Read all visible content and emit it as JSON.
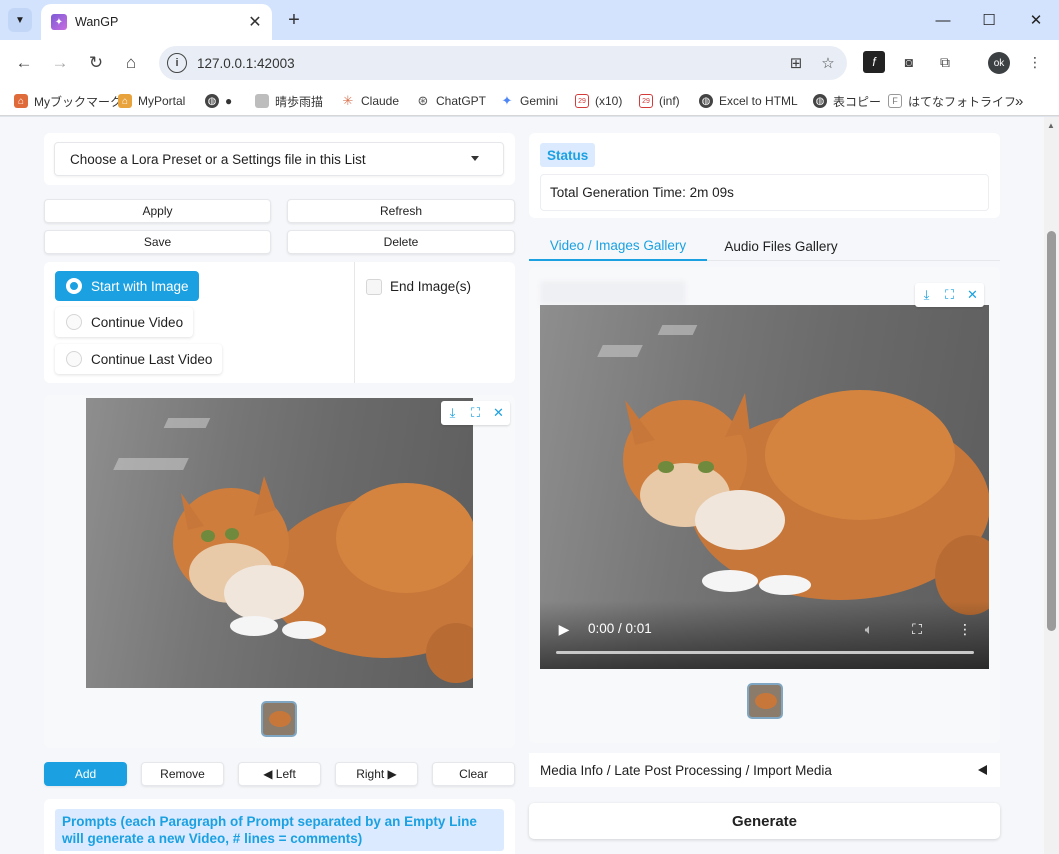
{
  "browser": {
    "tab_title": "WanGP",
    "url": "127.0.0.1:42003",
    "profile_initials": "ok",
    "bookmarks": [
      {
        "label": "Myブックマーク",
        "icon": "house-icon",
        "color": "#e06b3a"
      },
      {
        "label": "MyPortal",
        "icon": "house-icon",
        "color": "#e8a33c"
      },
      {
        "label": "●",
        "icon": "globe-icon",
        "color": "#444444"
      },
      {
        "label": "晴歩雨描",
        "icon": "page-icon",
        "color": "#9e9e9e"
      },
      {
        "label": "Claude",
        "icon": "claude-icon",
        "color": "#d97757"
      },
      {
        "label": "ChatGPT",
        "icon": "chatgpt-icon",
        "color": "#555555"
      },
      {
        "label": "Gemini",
        "icon": "gemini-icon",
        "color": "#4f86f7"
      },
      {
        "label": "(x10)",
        "icon": "calendar-icon",
        "color": "#d33b3b"
      },
      {
        "label": "(inf)",
        "icon": "calendar-icon",
        "color": "#d33b3b"
      },
      {
        "label": "Excel to HTML",
        "icon": "globe-icon",
        "color": "#444444"
      },
      {
        "label": "表コピー",
        "icon": "globe-icon",
        "color": "#444444"
      },
      {
        "label": "はてなフォトライフ",
        "icon": "hatena-icon",
        "color": "#777777"
      }
    ]
  },
  "left": {
    "preset_dropdown": "Choose a Lora Preset or a Settings file in this List",
    "buttons": {
      "apply": "Apply",
      "refresh": "Refresh",
      "save": "Save",
      "delete": "Delete"
    },
    "radios": [
      {
        "label": "Start with Image",
        "selected": true
      },
      {
        "label": "Continue Video",
        "selected": false
      },
      {
        "label": "Continue Last Video",
        "selected": false
      }
    ],
    "end_image_label": "End Image(s)",
    "gallery_buttons": {
      "add": "Add",
      "remove": "Remove",
      "left": "◀ Left",
      "right": "Right ▶",
      "clear": "Clear"
    },
    "prompt_label": "Prompts (each Paragraph of Prompt separated by an Empty Line will generate a new Video, # lines = comments)"
  },
  "right": {
    "status_label": "Status",
    "status_text": "Total Generation Time: 2m 09s",
    "tabs": [
      {
        "label": "Video / Images Gallery",
        "active": true
      },
      {
        "label": "Audio Files Gallery",
        "active": false
      }
    ],
    "video_time": "0:00 / 0:01",
    "accordion_label": "Media Info / Late Post Processing / Import Media",
    "generate_label": "Generate"
  },
  "colors": {
    "accent": "#1ba1e2",
    "accent_light": "#dbeafe",
    "chrome_tab_strip": "#d3e3fd"
  }
}
